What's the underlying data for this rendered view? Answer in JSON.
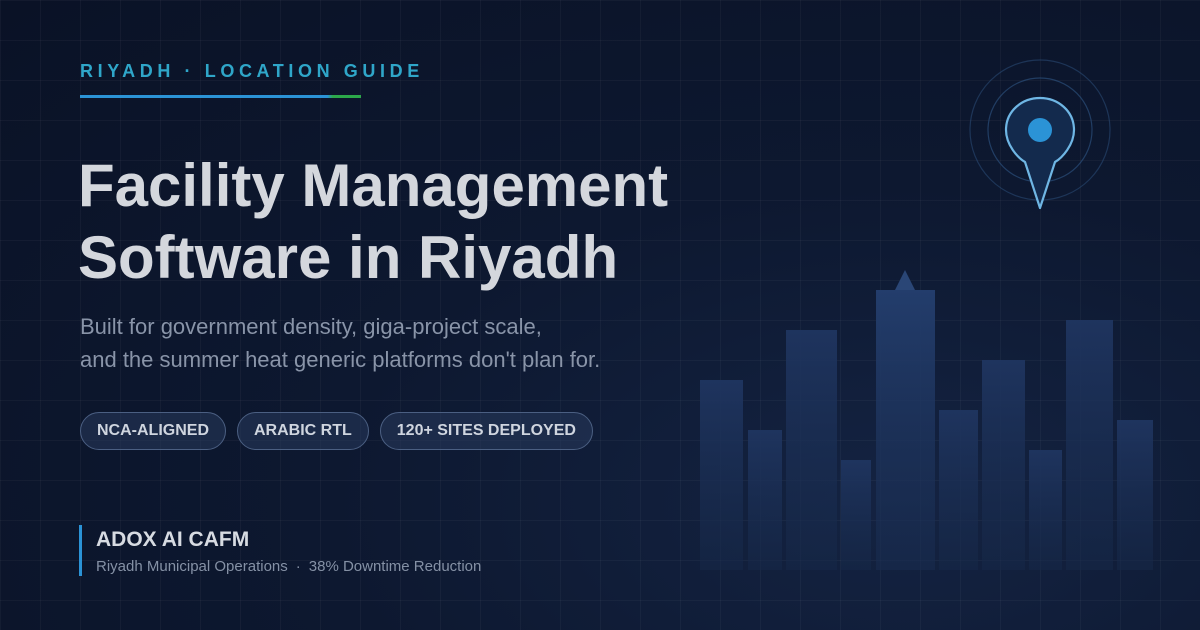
{
  "header": {
    "eyebrow": "RIYADH · LOCATION GUIDE",
    "headline_line1": "Facility Management",
    "headline_line2": "Software in Riyadh",
    "subtitle_line1": "Built for government density, giga-project scale,",
    "subtitle_line2": "and the summer heat generic platforms don't plan for."
  },
  "badges": [
    "NCA-ALIGNED",
    "ARABIC RTL",
    "120+ SITES DEPLOYED"
  ],
  "brand": {
    "name": "ADOX AI CAFM",
    "meta_left": "Riyadh Municipal Operations",
    "separator": "·",
    "meta_right": "38% Downtime Reduction"
  },
  "illustration": {
    "pin_icon": "location-pin-icon",
    "skyline": "city-skyline-illustration"
  },
  "colors": {
    "accent_blue": "#2b93d6",
    "accent_cyan": "#2fa6c9",
    "accent_green": "#2ca84a",
    "background": "#0d1830"
  }
}
